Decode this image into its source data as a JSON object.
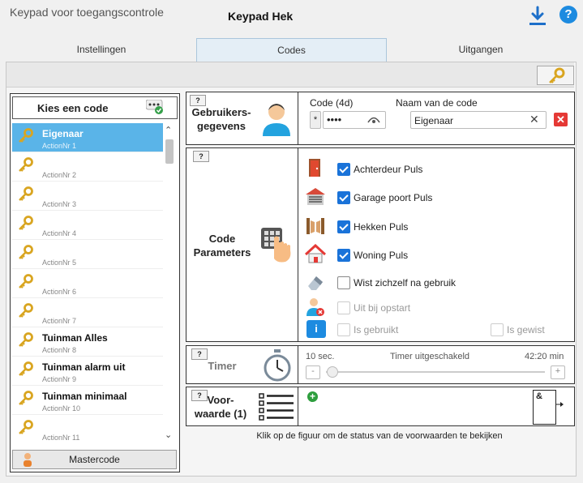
{
  "app": {
    "title": "Keypad voor toegangscontrole",
    "window_title": "Keypad Hek"
  },
  "tabs": [
    {
      "label": "Instellingen",
      "active": false
    },
    {
      "label": "Codes",
      "active": true
    },
    {
      "label": "Uitgangen",
      "active": false
    }
  ],
  "code_list": {
    "header": "Kies een code",
    "items": [
      {
        "name": "Eigenaar",
        "action": "ActionNr 1",
        "selected": true
      },
      {
        "name": "",
        "action": "ActionNr 2"
      },
      {
        "name": "",
        "action": "ActionNr 3"
      },
      {
        "name": "",
        "action": "ActionNr 4"
      },
      {
        "name": "",
        "action": "ActionNr 5"
      },
      {
        "name": "",
        "action": "ActionNr 6"
      },
      {
        "name": "",
        "action": "ActionNr 7"
      },
      {
        "name": "Tuinman Alles",
        "action": "ActionNr 8"
      },
      {
        "name": "Tuinman alarm uit",
        "action": "ActionNr 9"
      },
      {
        "name": "Tuinman minimaal",
        "action": "ActionNr 10"
      },
      {
        "name": "",
        "action": "ActionNr 11"
      }
    ],
    "master_button": "Mastercode"
  },
  "user_data": {
    "help": "?",
    "title_line1": "Gebruikers-",
    "title_line2": "gegevens",
    "code_label": "Code (4d)",
    "code_prefix": "*",
    "code_value": "••••",
    "name_label": "Naam van de code",
    "name_value": "Eigenaar"
  },
  "parameters": {
    "help": "?",
    "title_line1": "Code",
    "title_line2": "Parameters",
    "options": [
      {
        "label": "Achterdeur Puls",
        "checked": true,
        "disabled": false,
        "icon": "door-icon"
      },
      {
        "label": "Garage poort Puls",
        "checked": true,
        "disabled": false,
        "icon": "garage-icon"
      },
      {
        "label": "Hekken Puls",
        "checked": true,
        "disabled": false,
        "icon": "gate-icon"
      },
      {
        "label": "Woning Puls",
        "checked": true,
        "disabled": false,
        "icon": "house-icon"
      },
      {
        "label": "Wist zichzelf na gebruik",
        "checked": false,
        "disabled": false,
        "icon": "eraser-icon"
      },
      {
        "label": "Uit bij opstart",
        "checked": false,
        "disabled": true,
        "icon": "user-off-icon"
      }
    ],
    "is_used_label": "Is gebruikt",
    "is_erased_label": "Is gewist"
  },
  "timer": {
    "help": "?",
    "title": "Timer",
    "min_label": "10 sec.",
    "status_label": "Timer uitgeschakeld",
    "max_label": "42:20 min",
    "minus": "-",
    "plus": "+",
    "slider_value": 0
  },
  "condition": {
    "help": "?",
    "title_line1": "Voor-",
    "title_line2": "waarde (1)",
    "gate_symbol": "&",
    "hint": "Klik op de figuur om de status van de voorwaarden te bekijken"
  },
  "colors": {
    "accent": "#1a73d9",
    "selection": "#5ab4e8",
    "delete": "#e53935",
    "add": "#2e9e3e"
  }
}
